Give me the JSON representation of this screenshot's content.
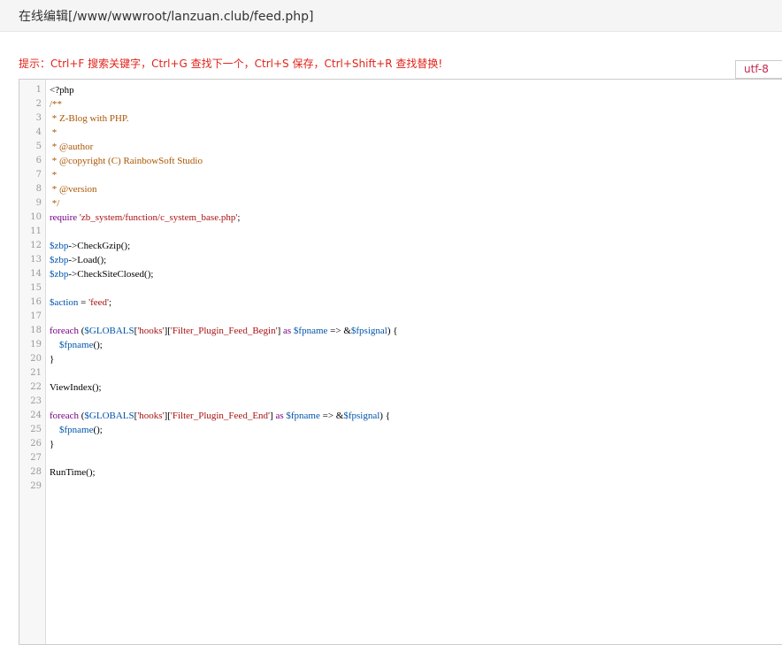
{
  "header": {
    "title": "在线编辑[/www/wwwroot/lanzuan.club/feed.php]"
  },
  "hint": "提示：Ctrl+F 搜索关键字，Ctrl+G 查找下一个，Ctrl+S 保存，Ctrl+Shift+R 查找替换!",
  "encoding": "utf-8",
  "editor": {
    "line_numbers": [
      "1",
      "2",
      "3",
      "4",
      "5",
      "6",
      "7",
      "8",
      "9",
      "10",
      "11",
      "12",
      "13",
      "14",
      "15",
      "16",
      "17",
      "18",
      "19",
      "20",
      "21",
      "22",
      "23",
      "24",
      "25",
      "26",
      "27",
      "28",
      "29"
    ],
    "lines": [
      [
        {
          "t": "<?php",
          "c": "tag"
        }
      ],
      [
        {
          "t": "/**",
          "c": "com"
        }
      ],
      [
        {
          "t": " * Z-Blog with PHP.",
          "c": "com"
        }
      ],
      [
        {
          "t": " *",
          "c": "com"
        }
      ],
      [
        {
          "t": " * @author",
          "c": "com"
        }
      ],
      [
        {
          "t": " * @copyright (C) RainbowSoft Studio",
          "c": "com"
        }
      ],
      [
        {
          "t": " *",
          "c": "com"
        }
      ],
      [
        {
          "t": " * @version",
          "c": "com"
        }
      ],
      [
        {
          "t": " */",
          "c": "com"
        }
      ],
      [
        {
          "t": "require",
          "c": "kw"
        },
        {
          "t": " ",
          "c": "def"
        },
        {
          "t": "'zb_system/function/c_system_base.php'",
          "c": "str"
        },
        {
          "t": ";",
          "c": "def"
        }
      ],
      [],
      [
        {
          "t": "$zbp",
          "c": "var"
        },
        {
          "t": "->CheckGzip();",
          "c": "def"
        }
      ],
      [
        {
          "t": "$zbp",
          "c": "var"
        },
        {
          "t": "->Load();",
          "c": "def"
        }
      ],
      [
        {
          "t": "$zbp",
          "c": "var"
        },
        {
          "t": "->CheckSiteClosed();",
          "c": "def"
        }
      ],
      [],
      [
        {
          "t": "$action",
          "c": "var"
        },
        {
          "t": " = ",
          "c": "def"
        },
        {
          "t": "'feed'",
          "c": "str"
        },
        {
          "t": ";",
          "c": "def"
        }
      ],
      [],
      [
        {
          "t": "foreach",
          "c": "kw"
        },
        {
          "t": " (",
          "c": "def"
        },
        {
          "t": "$GLOBALS",
          "c": "var"
        },
        {
          "t": "[",
          "c": "def"
        },
        {
          "t": "'hooks'",
          "c": "str"
        },
        {
          "t": "][",
          "c": "def"
        },
        {
          "t": "'Filter_Plugin_Feed_Begin'",
          "c": "str"
        },
        {
          "t": "] ",
          "c": "def"
        },
        {
          "t": "as",
          "c": "kw"
        },
        {
          "t": " ",
          "c": "def"
        },
        {
          "t": "$fpname",
          "c": "var"
        },
        {
          "t": " => &",
          "c": "def"
        },
        {
          "t": "$fpsignal",
          "c": "var"
        },
        {
          "t": ") {",
          "c": "def"
        }
      ],
      [
        {
          "t": "    ",
          "c": "def"
        },
        {
          "t": "$fpname",
          "c": "var"
        },
        {
          "t": "();",
          "c": "def"
        }
      ],
      [
        {
          "t": "}",
          "c": "def"
        }
      ],
      [],
      [
        {
          "t": "ViewIndex();",
          "c": "def"
        }
      ],
      [],
      [
        {
          "t": "foreach",
          "c": "kw"
        },
        {
          "t": " (",
          "c": "def"
        },
        {
          "t": "$GLOBALS",
          "c": "var"
        },
        {
          "t": "[",
          "c": "def"
        },
        {
          "t": "'hooks'",
          "c": "str"
        },
        {
          "t": "][",
          "c": "def"
        },
        {
          "t": "'Filter_Plugin_Feed_End'",
          "c": "str"
        },
        {
          "t": "] ",
          "c": "def"
        },
        {
          "t": "as",
          "c": "kw"
        },
        {
          "t": " ",
          "c": "def"
        },
        {
          "t": "$fpname",
          "c": "var"
        },
        {
          "t": " => &",
          "c": "def"
        },
        {
          "t": "$fpsignal",
          "c": "var"
        },
        {
          "t": ") {",
          "c": "def"
        }
      ],
      [
        {
          "t": "    ",
          "c": "def"
        },
        {
          "t": "$fpname",
          "c": "var"
        },
        {
          "t": "();",
          "c": "def"
        }
      ],
      [
        {
          "t": "}",
          "c": "def"
        }
      ],
      [],
      [
        {
          "t": "RunTime();",
          "c": "def"
        }
      ],
      []
    ]
  }
}
